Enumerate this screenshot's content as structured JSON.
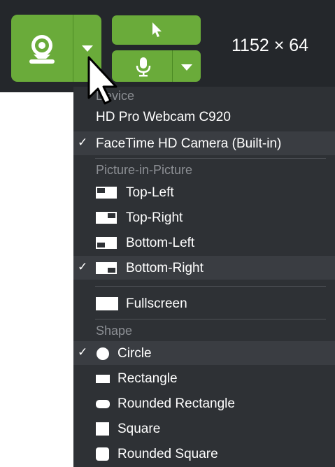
{
  "toolbar": {
    "dimensions_text": "1152 × 64"
  },
  "menu": {
    "device_header": "Device",
    "devices": [
      "HD Pro Webcam C920",
      "FaceTime HD Camera (Built-in)"
    ],
    "pip_header": "Picture-in-Picture",
    "pip": [
      "Top-Left",
      "Top-Right",
      "Bottom-Left",
      "Bottom-Right"
    ],
    "fullscreen": "Fullscreen",
    "shape_header": "Shape",
    "shapes": [
      "Circle",
      "Rectangle",
      "Rounded Rectangle",
      "Square",
      "Rounded Square"
    ],
    "check_mark": "✓",
    "selected": {
      "device": "FaceTime HD Camera (Built-in)",
      "pip": "Bottom-Right",
      "shape": "Circle"
    }
  },
  "colors": {
    "accent_green": "#6aab3a",
    "toolbar_bg": "#24272b",
    "menu_bg": "#2e3135",
    "highlight_bg": "#3a3d42",
    "header_text": "#8c8f94"
  },
  "icons": [
    "webcam-icon",
    "chevron-down-icon",
    "pointer-icon",
    "microphone-icon",
    "mouse-cursor-icon",
    "check-icon",
    "pip-top-left-icon",
    "pip-top-right-icon",
    "pip-bottom-left-icon",
    "pip-bottom-right-icon",
    "fullscreen-icon",
    "circle-shape-icon",
    "rectangle-shape-icon",
    "rounded-rectangle-shape-icon",
    "square-shape-icon",
    "rounded-square-shape-icon"
  ]
}
